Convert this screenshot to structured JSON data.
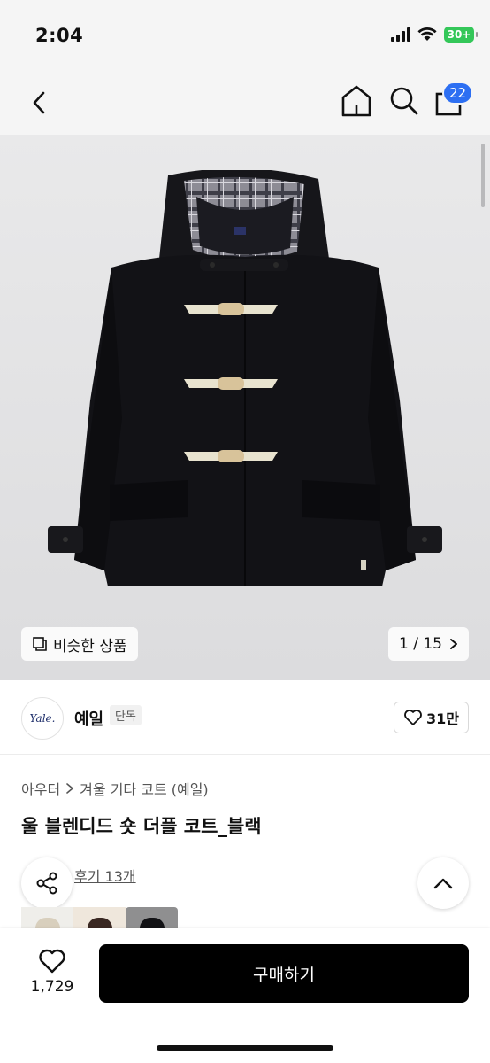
{
  "status": {
    "time": "2:04",
    "battery": "30+"
  },
  "nav": {
    "back_icon": "chevron-left-icon",
    "home_icon": "home-icon",
    "search_icon": "search-icon",
    "cart_icon": "shopping-bag-icon",
    "cart_count": "22"
  },
  "gallery": {
    "similar_label": "비슷한 상품",
    "counter": "1 / 15",
    "similar_icon": "copy-icon",
    "next_icon": "chevron-right-icon"
  },
  "brand": {
    "logo_text": "Yale.",
    "name": "예일",
    "tag": "단독",
    "like_count": "31만"
  },
  "product": {
    "category_parent": "아우터",
    "category_child": "겨울 기타 코트 (예일)",
    "title": "울 블렌디드 숏 더플 코트_블랙",
    "review_link": "후기 13개"
  },
  "bottom": {
    "wish_count": "1,729",
    "buy_label": "구매하기"
  },
  "colors": {
    "accent": "#2d6ff2",
    "buy_button": "#000000",
    "battery": "#34c759"
  }
}
